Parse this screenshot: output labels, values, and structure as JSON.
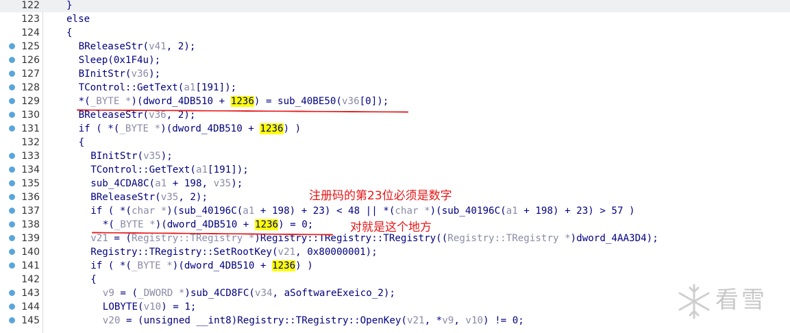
{
  "editor": {
    "lines": [
      {
        "n": "122",
        "bp": false,
        "hl": true,
        "i": 2,
        "t": [
          [
            "}",
            "n"
          ]
        ]
      },
      {
        "n": "123",
        "bp": false,
        "i": 2,
        "t": [
          [
            "else",
            "n"
          ]
        ]
      },
      {
        "n": "124",
        "bp": false,
        "i": 2,
        "t": [
          [
            "{",
            "n"
          ]
        ]
      },
      {
        "n": "125",
        "bp": true,
        "i": 4,
        "t": [
          [
            "BReleaseStr(",
            "n"
          ],
          [
            "v41",
            "v"
          ],
          [
            ", 2);",
            "n"
          ]
        ]
      },
      {
        "n": "126",
        "bp": true,
        "i": 4,
        "t": [
          [
            "Sleep(0x1F4u);",
            "n"
          ]
        ]
      },
      {
        "n": "127",
        "bp": true,
        "i": 4,
        "t": [
          [
            "BInitStr(",
            "n"
          ],
          [
            "v36",
            "v"
          ],
          [
            ");",
            "n"
          ]
        ]
      },
      {
        "n": "128",
        "bp": true,
        "i": 4,
        "t": [
          [
            "TControl::GetText(",
            "n"
          ],
          [
            "a1",
            "v"
          ],
          [
            "[191]);",
            "n"
          ]
        ]
      },
      {
        "n": "129",
        "bp": true,
        "i": 4,
        "t": [
          [
            "*(",
            "n"
          ],
          [
            "_BYTE *",
            "v"
          ],
          [
            ")(dword_4DB510 + ",
            "n"
          ],
          [
            "1236",
            "y"
          ],
          [
            ") = sub_40BE50(",
            "n"
          ],
          [
            "v36",
            "v"
          ],
          [
            "[0]);",
            "n"
          ]
        ]
      },
      {
        "n": "130",
        "bp": true,
        "i": 4,
        "t": [
          [
            "BReleaseStr(",
            "n"
          ],
          [
            "v36",
            "v"
          ],
          [
            ", 2);",
            "n"
          ]
        ]
      },
      {
        "n": "131",
        "bp": true,
        "i": 4,
        "t": [
          [
            "if ( *(",
            "n"
          ],
          [
            "_BYTE *",
            "v"
          ],
          [
            ")(dword_4DB510 + ",
            "n"
          ],
          [
            "1236",
            "y"
          ],
          [
            ") )",
            "n"
          ]
        ]
      },
      {
        "n": "132",
        "bp": false,
        "i": 4,
        "t": [
          [
            "{",
            "n"
          ]
        ]
      },
      {
        "n": "133",
        "bp": true,
        "i": 6,
        "t": [
          [
            "BInitStr(",
            "n"
          ],
          [
            "v35",
            "v"
          ],
          [
            ");",
            "n"
          ]
        ]
      },
      {
        "n": "134",
        "bp": true,
        "i": 6,
        "t": [
          [
            "TControl::GetText(",
            "n"
          ],
          [
            "a1",
            "v"
          ],
          [
            "[191]);",
            "n"
          ]
        ]
      },
      {
        "n": "135",
        "bp": true,
        "i": 6,
        "t": [
          [
            "sub_4CDA8C(",
            "n"
          ],
          [
            "a1",
            "v"
          ],
          [
            " + 198, ",
            "n"
          ],
          [
            "v35",
            "v"
          ],
          [
            ");",
            "n"
          ]
        ]
      },
      {
        "n": "136",
        "bp": true,
        "i": 6,
        "t": [
          [
            "BReleaseStr(",
            "n"
          ],
          [
            "v35",
            "v"
          ],
          [
            ", 2);",
            "n"
          ]
        ]
      },
      {
        "n": "137",
        "bp": true,
        "i": 6,
        "t": [
          [
            "if ( *(",
            "n"
          ],
          [
            "char *",
            "v"
          ],
          [
            ")(sub_40196C(",
            "n"
          ],
          [
            "a1",
            "v"
          ],
          [
            " + 198) + 23) < 48 || *(",
            "n"
          ],
          [
            "char *",
            "v"
          ],
          [
            ")(sub_40196C(",
            "n"
          ],
          [
            "a1",
            "v"
          ],
          [
            " + 198) + 23) > 57 )",
            "n"
          ]
        ]
      },
      {
        "n": "138",
        "bp": true,
        "i": 8,
        "t": [
          [
            "*(",
            "n"
          ],
          [
            "_BYTE *",
            "v"
          ],
          [
            ")(dword_4DB510 + ",
            "n"
          ],
          [
            "1236",
            "y"
          ],
          [
            ") = 0;",
            "n"
          ]
        ]
      },
      {
        "n": "139",
        "bp": true,
        "i": 6,
        "t": [
          [
            "v21",
            "v"
          ],
          [
            " = (",
            "n"
          ],
          [
            "Registry::TRegistry *",
            "v"
          ],
          [
            ")Registry::TRegistry::TRegistry((",
            "n"
          ],
          [
            "Registry::TRegistry *",
            "v"
          ],
          [
            ")dword_4AA3D4);",
            "n"
          ]
        ]
      },
      {
        "n": "140",
        "bp": true,
        "i": 6,
        "t": [
          [
            "Registry::TRegistry::SetRootKey(",
            "n"
          ],
          [
            "v21",
            "v"
          ],
          [
            ", 0x80000001);",
            "n"
          ]
        ]
      },
      {
        "n": "141",
        "bp": true,
        "i": 6,
        "t": [
          [
            "if ( *(",
            "n"
          ],
          [
            "_BYTE *",
            "v"
          ],
          [
            ")(dword_4DB510 + ",
            "n"
          ],
          [
            "1236",
            "y"
          ],
          [
            ") )",
            "n"
          ]
        ]
      },
      {
        "n": "142",
        "bp": false,
        "i": 6,
        "t": [
          [
            "{",
            "n"
          ]
        ]
      },
      {
        "n": "143",
        "bp": true,
        "i": 8,
        "t": [
          [
            "v9",
            "v"
          ],
          [
            " = (",
            "n"
          ],
          [
            "_DWORD *",
            "v"
          ],
          [
            ")sub_4CD8FC(",
            "n"
          ],
          [
            "v34",
            "v"
          ],
          [
            ", aSoftwareExeico_2);",
            "n"
          ]
        ]
      },
      {
        "n": "144",
        "bp": true,
        "i": 8,
        "t": [
          [
            "LOBYTE(",
            "n"
          ],
          [
            "v10",
            "v"
          ],
          [
            ") = 1;",
            "n"
          ]
        ]
      },
      {
        "n": "145",
        "bp": true,
        "i": 8,
        "t": [
          [
            "v20",
            "v"
          ],
          [
            " = (unsigned __int8)Registry::TRegistry::OpenKey(",
            "n"
          ],
          [
            "v21",
            "v"
          ],
          [
            ", *",
            "n"
          ],
          [
            "v9",
            "v"
          ],
          [
            ", ",
            "n"
          ],
          [
            "v10",
            "v"
          ],
          [
            ") != 0;",
            "n"
          ]
        ]
      }
    ]
  },
  "annotations": {
    "note1": "注册码的第23位必须是数字",
    "note2": "对就是这个地方"
  },
  "watermark": {
    "text": "看雪",
    "icon": "snowflake-icon"
  },
  "colors": {
    "code": "#000080",
    "variable": "#8a8aa6",
    "highlight": "#ffff00",
    "breakpoint": "#5aa6dc",
    "annotation": "#e51c1c"
  }
}
